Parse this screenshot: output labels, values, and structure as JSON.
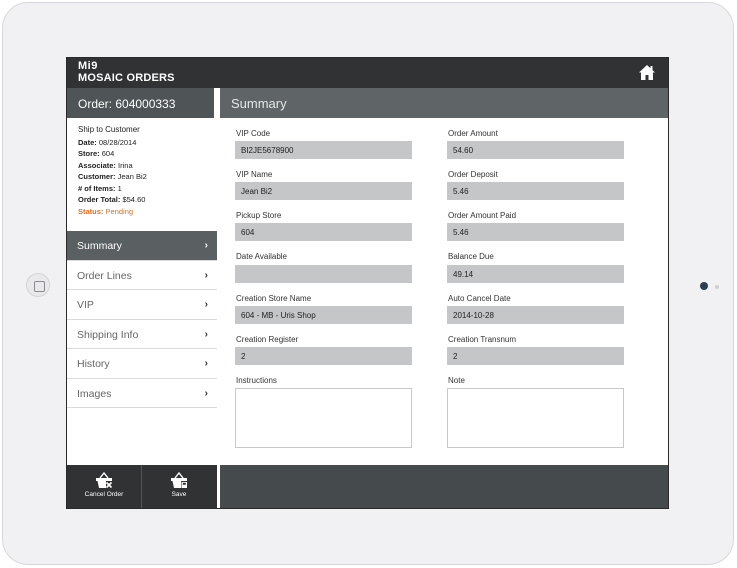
{
  "app": {
    "brand_top": "Mi9",
    "brand_bottom": "MOSAIC ORDERS"
  },
  "order": {
    "title": "Order: 604000333",
    "ship_type": "Ship to Customer",
    "date_label": "Date:",
    "date": "08/28/2014",
    "store_label": "Store:",
    "store": "604",
    "associate_label": "Associate:",
    "associate": "Irina",
    "customer_label": "Customer:",
    "customer": "Jean Bi2",
    "items_label": "# of Items:",
    "items": "1",
    "total_label": "Order Total:",
    "total": "$54.60",
    "status_label": "Status:",
    "status": "Pending"
  },
  "nav": {
    "items": [
      {
        "label": "Summary",
        "active": true
      },
      {
        "label": "Order Lines",
        "active": false
      },
      {
        "label": "VIP",
        "active": false
      },
      {
        "label": "Shipping Info",
        "active": false
      },
      {
        "label": "History",
        "active": false
      },
      {
        "label": "Images",
        "active": false
      }
    ],
    "chevron": "›"
  },
  "actions": {
    "cancel_label": "Cancel Order",
    "save_label": "Save"
  },
  "summary": {
    "title": "Summary",
    "left": [
      {
        "label": "VIP Code",
        "value": "BI2JE5678900"
      },
      {
        "label": "VIP Name",
        "value": "Jean Bi2"
      },
      {
        "label": "Pickup Store",
        "value": "604"
      },
      {
        "label": "Date Available",
        "value": ""
      },
      {
        "label": "Creation Store Name",
        "value": "604 - MB - Uris Shop"
      },
      {
        "label": "Creation Register",
        "value": "2"
      }
    ],
    "right": [
      {
        "label": "Order Amount",
        "value": "54.60"
      },
      {
        "label": "Order Deposit",
        "value": "5.46"
      },
      {
        "label": "Order Amount Paid",
        "value": "5.46"
      },
      {
        "label": "Balance Due",
        "value": "49.14"
      },
      {
        "label": "Auto Cancel Date",
        "value": "2014-10-28"
      },
      {
        "label": "Creation Transnum",
        "value": "2"
      }
    ],
    "instructions_label": "Instructions",
    "instructions_value": "",
    "note_label": "Note",
    "note_value": ""
  },
  "colors": {
    "topbar": "#303234",
    "status": "#e0701f",
    "active_nav": "#5a5f61"
  }
}
